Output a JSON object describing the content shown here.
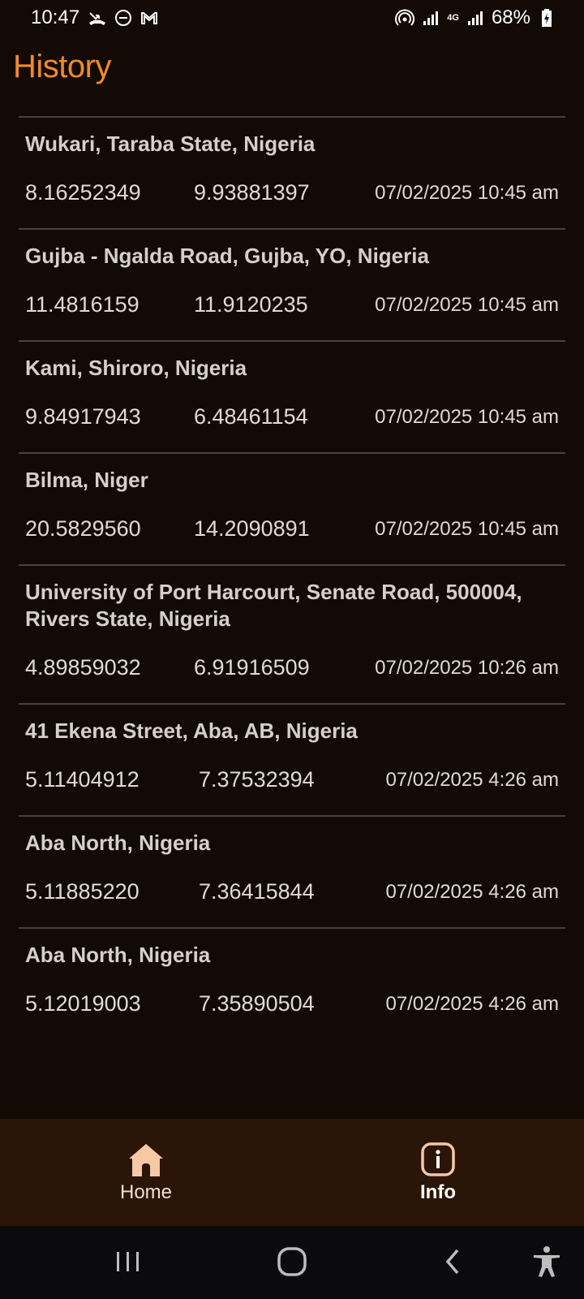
{
  "status_bar": {
    "time": "10:47",
    "battery": "68%",
    "network": "4G"
  },
  "header": {
    "title": "History"
  },
  "history": [
    {
      "place": "Wukari, Taraba State, Nigeria",
      "lat": "8.16252349",
      "lng": "9.93881397",
      "time": "07/02/2025 10:45 am"
    },
    {
      "place": "Gujba - Ngalda Road, Gujba, YO, Nigeria",
      "lat": "11.4816159",
      "lng": "11.9120235",
      "time": "07/02/2025 10:45 am"
    },
    {
      "place": "Kami, Shiroro, Nigeria",
      "lat": "9.84917943",
      "lng": "6.48461154",
      "time": "07/02/2025 10:45 am"
    },
    {
      "place": "Bilma, Niger",
      "lat": "20.5829560",
      "lng": "14.2090891",
      "time": "07/02/2025 10:45 am"
    },
    {
      "place": "University of Port Harcourt, Senate Road, 500004, Rivers State, Nigeria",
      "lat": "4.89859032",
      "lng": "6.91916509",
      "time": "07/02/2025 10:26 am"
    },
    {
      "place": "41 Ekena Street, Aba, AB, Nigeria",
      "lat": "5.11404912",
      "lng": "7.37532394",
      "time": "07/02/2025 4:26 am"
    },
    {
      "place": "Aba North, Nigeria",
      "lat": "5.11885220",
      "lng": "7.36415844",
      "time": "07/02/2025 4:26 am"
    },
    {
      "place": "Aba North, Nigeria",
      "lat": "5.12019003",
      "lng": "7.35890504",
      "time": "07/02/2025 4:26 am"
    }
  ],
  "bottom_nav": {
    "home_label": "Home",
    "info_label": "Info"
  },
  "colors": {
    "accent": "#f08a2a",
    "background": "#130a06",
    "nav_background": "#2a1508",
    "icon_fill": "#f6c8a4"
  }
}
